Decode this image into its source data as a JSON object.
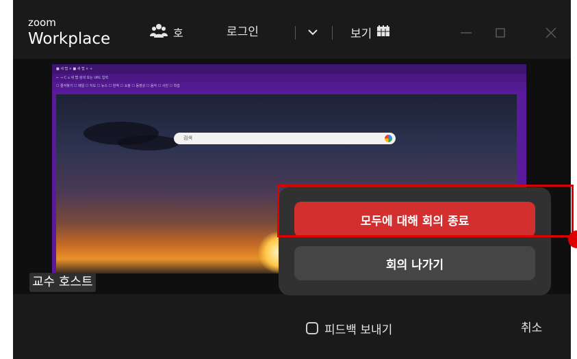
{
  "header": {
    "logo_line1": "zoom",
    "logo_line2": "Workplace",
    "participants_label": "호",
    "login_label": "로그인",
    "view_label": "보기"
  },
  "shared_screen": {
    "tabs_text": "■ 새 탭  ×  ■ 새 탭  ×  +",
    "address_text": "← → C  ⌂  새 탭 검색 또는 URL 입력",
    "bookmarks_text": "☐ 즐겨찾기 ☐ 메일 ☐ 지도 ☐ 뉴스 ☐ 번역 ☐ 쇼핑 ☐ 동영상 ☐ 음악 ☐ 사진 ☐ 학습",
    "search_placeholder": "검색"
  },
  "participant_name": "교수 호스트",
  "end_meeting_dialog": {
    "end_for_all_label": "모두에 대해 회의 종료",
    "leave_label": "회의 나가기"
  },
  "footer": {
    "feedback_label": "피드백 보내기",
    "cancel_label": "취소"
  },
  "colors": {
    "end_button": "#d32f2f",
    "highlight": "#e00000",
    "window_bg": "#1a1a1a"
  }
}
